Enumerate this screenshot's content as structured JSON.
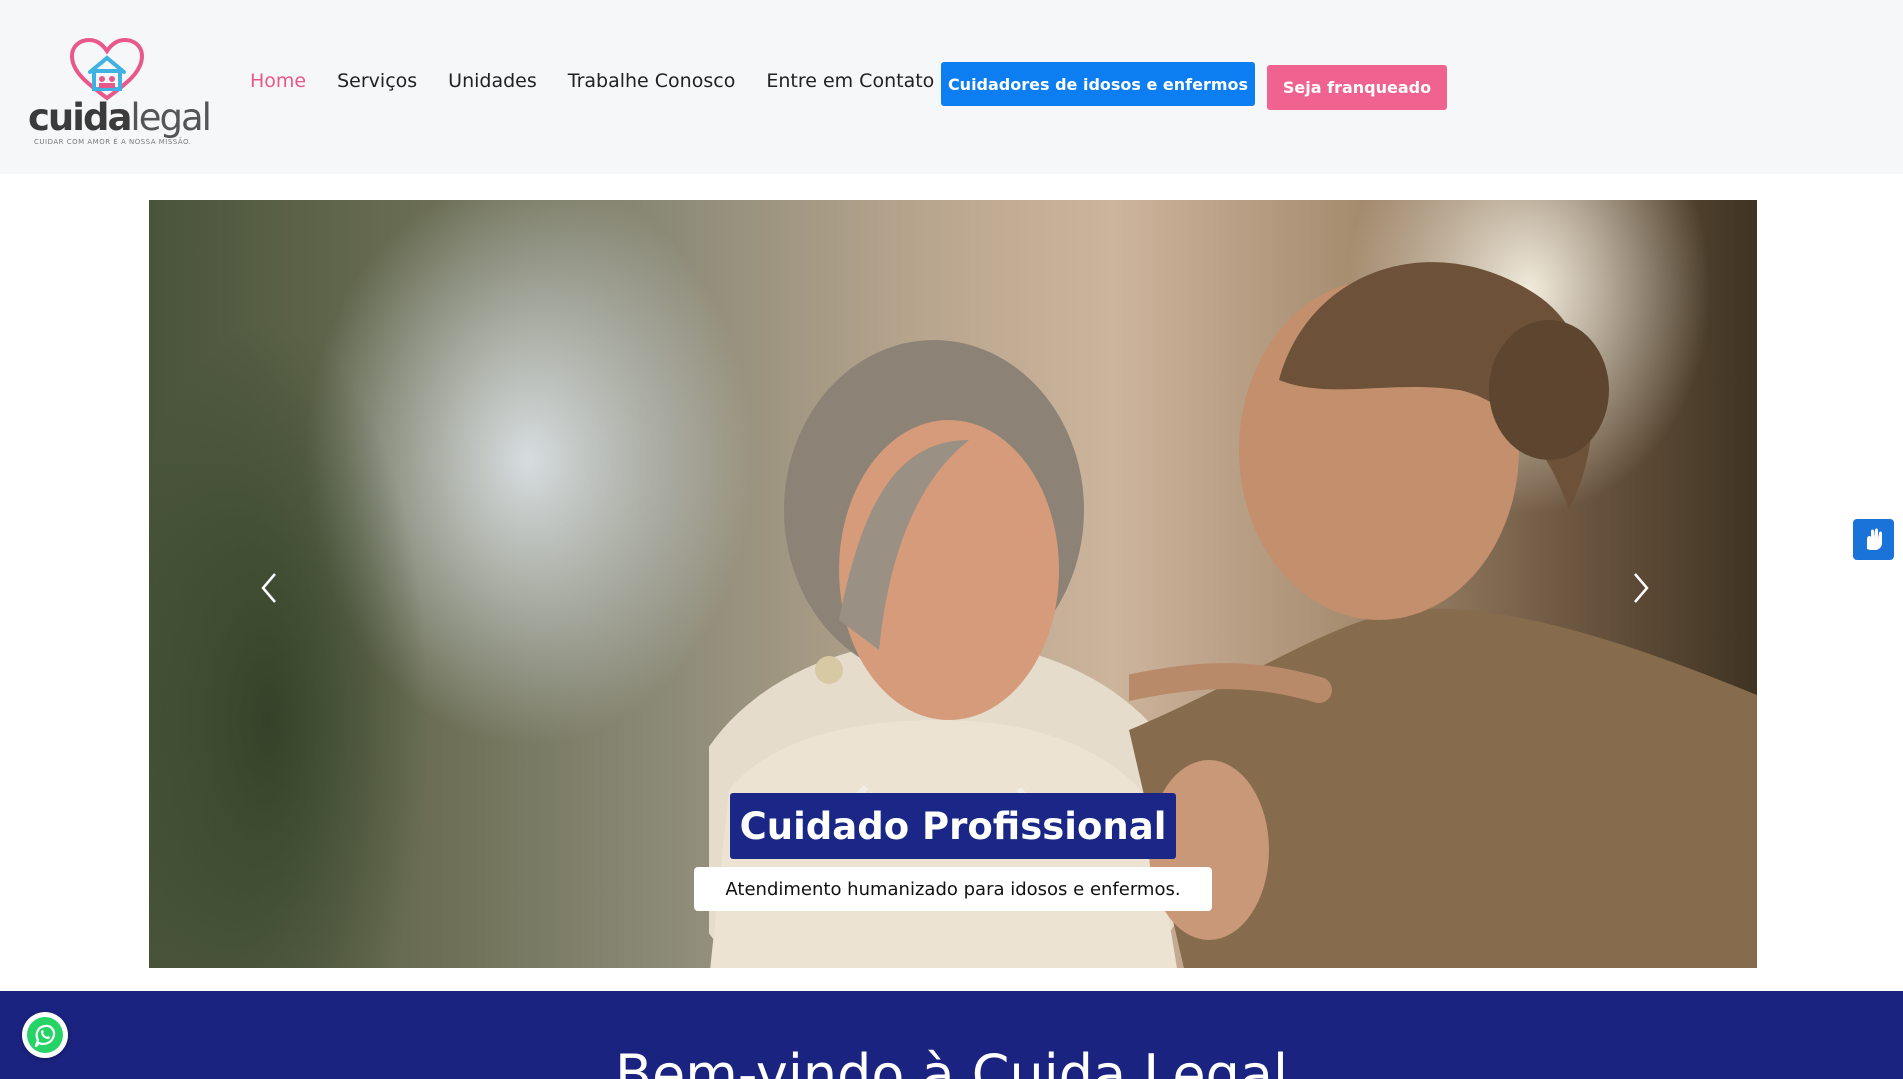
{
  "brand": {
    "name_bold": "cuida",
    "name_light": "legal",
    "tagline": "CUIDAR COM AMOR É A NOSSA MISSÃO."
  },
  "nav": {
    "items": [
      {
        "label": "Home",
        "active": true
      },
      {
        "label": "Serviços",
        "active": false
      },
      {
        "label": "Unidades",
        "active": false
      },
      {
        "label": "Trabalhe Conosco",
        "active": false
      },
      {
        "label": "Entre em Contato",
        "active": false
      }
    ],
    "cta_primary": "Cuidadores de idosos e enfermos",
    "cta_secondary": "Seja franqueado"
  },
  "hero": {
    "title": "Cuidado Profissional",
    "subtitle": "Atendimento humanizado para idosos e enfermos."
  },
  "welcome": {
    "title": "Bem-vindo à Cuida Legal"
  },
  "colors": {
    "brand_pink": "#f0628f",
    "brand_blue": "#0d7ef2",
    "navy": "#1b2381",
    "header_bg": "#f6f7f9"
  },
  "icons": {
    "prev": "chevron-left-icon",
    "next": "chevron-right-icon",
    "accessibility": "sign-language-icon",
    "chat": "whatsapp-icon",
    "logo": "heart-house-icon"
  }
}
